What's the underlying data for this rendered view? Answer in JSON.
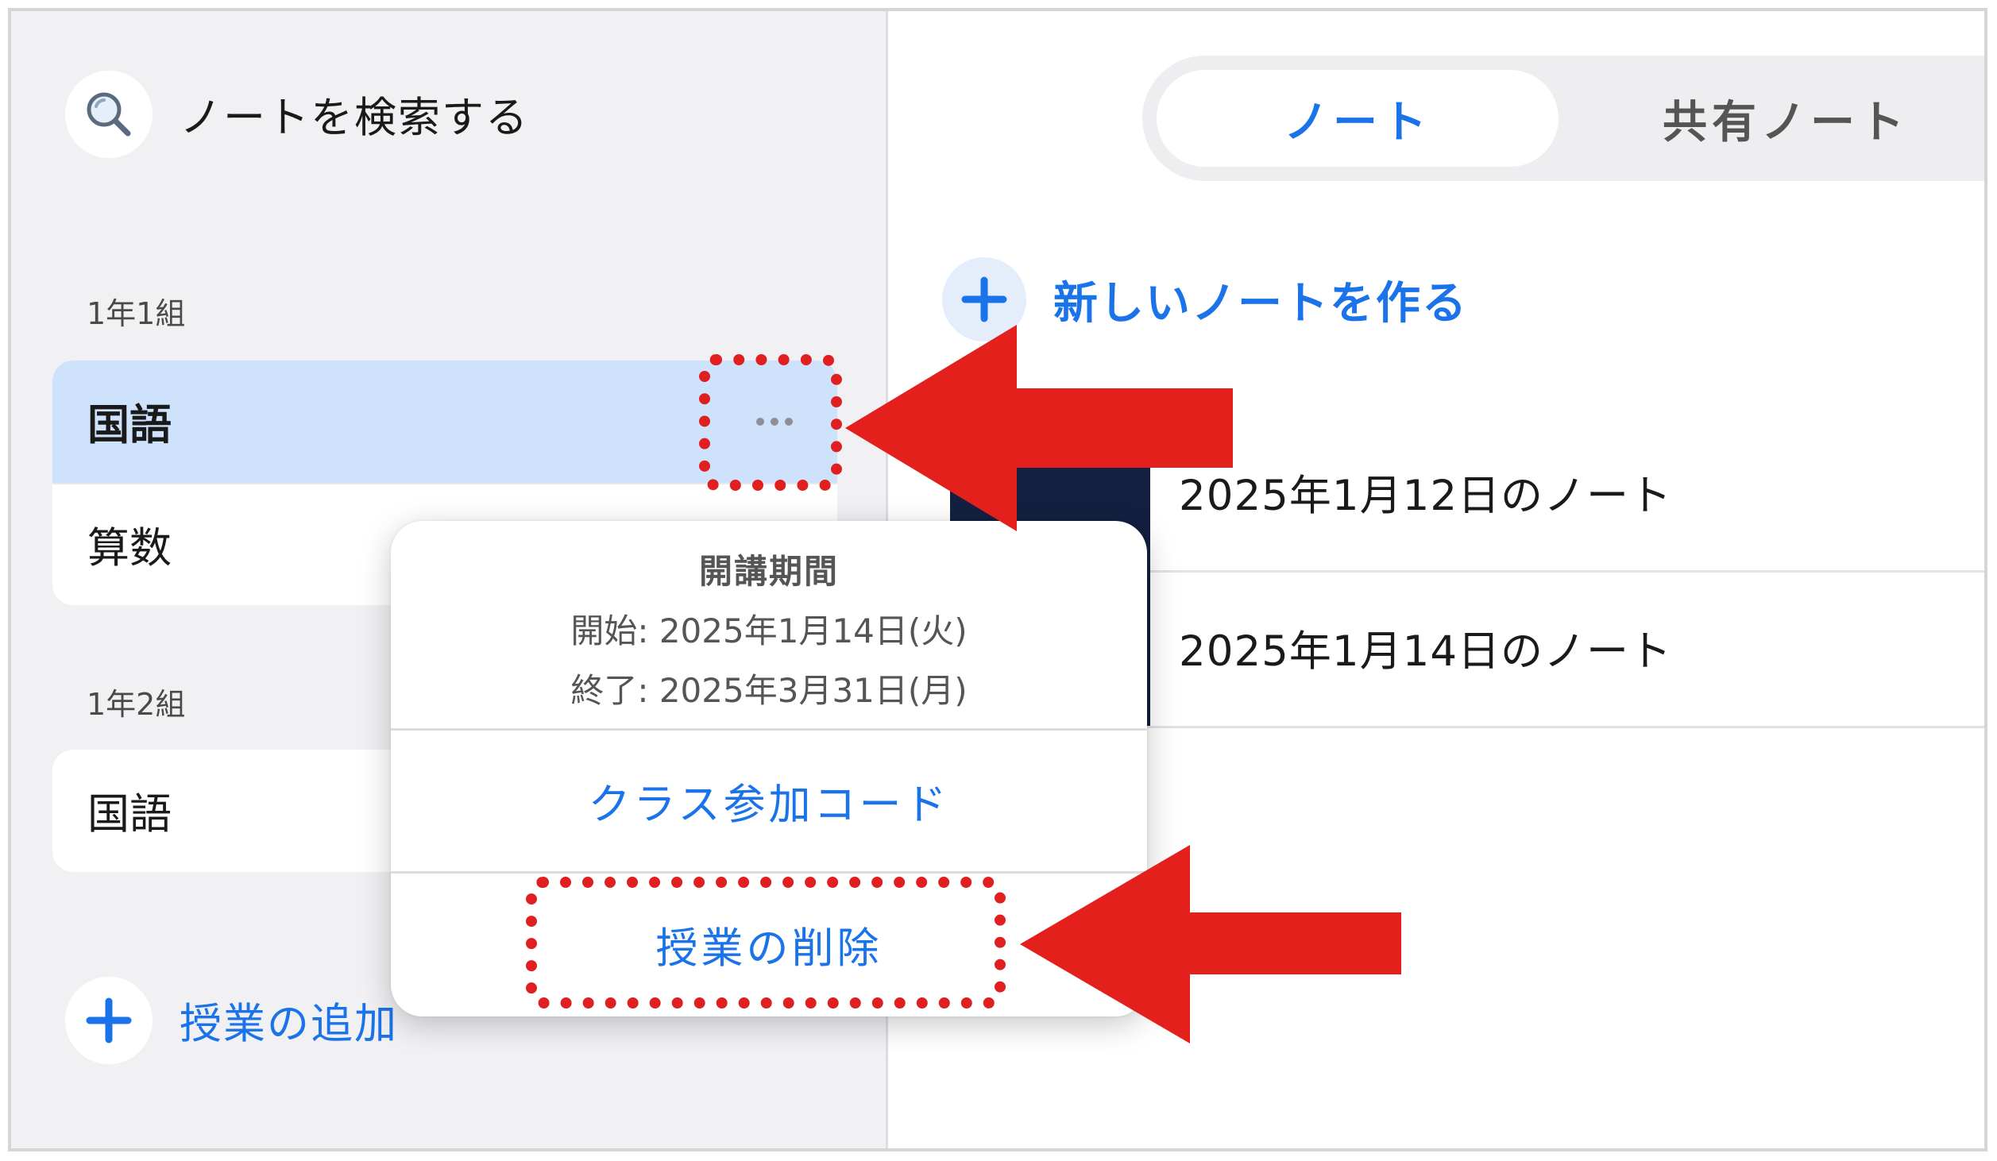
{
  "sidebar": {
    "search_label": "ノートを検索する",
    "groups": [
      {
        "label": "1年1組",
        "items": [
          {
            "label": "国語",
            "selected": true
          },
          {
            "label": "算数",
            "selected": false
          }
        ]
      },
      {
        "label": "1年2組",
        "items": [
          {
            "label": "国語",
            "selected": false
          }
        ]
      }
    ],
    "add_label": "授業の追加"
  },
  "main": {
    "tabs": [
      {
        "label": "ノート",
        "active": true
      },
      {
        "label": "共有ノート",
        "active": false
      }
    ],
    "new_note_label": "新しいノートを作る",
    "notes": [
      {
        "title": "2025年1月12日のノート"
      },
      {
        "title": "2025年1月14日のノート"
      }
    ]
  },
  "popover": {
    "title": "開講期間",
    "start": "開始: 2025年1月14日(火)",
    "end": "終了: 2025年3月31日(月)",
    "actions": [
      "クラス参加コード",
      "授業の削除"
    ]
  },
  "colors": {
    "accent": "#1a73e8",
    "annotation": "#e02020",
    "selected_bg": "#cfe2fb",
    "thumb": "#132040"
  },
  "icons": {
    "search": "search-icon",
    "more": "more-horizontal-icon",
    "add": "plus-icon"
  }
}
